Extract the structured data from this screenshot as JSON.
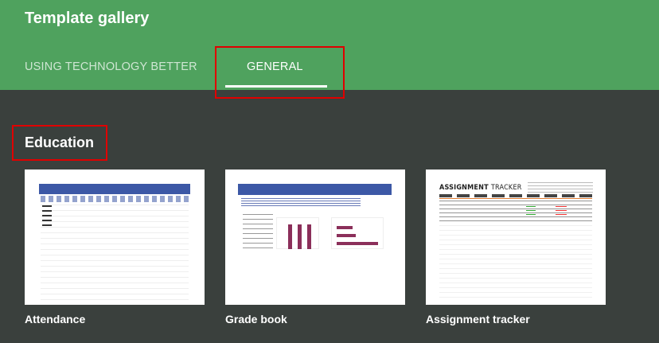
{
  "header": {
    "title": "Template gallery",
    "tabs": [
      {
        "label": "USING TECHNOLOGY BETTER",
        "selected": false
      },
      {
        "label": "GENERAL",
        "selected": true
      }
    ]
  },
  "section": {
    "title": "Education"
  },
  "templates": [
    {
      "label": "Attendance"
    },
    {
      "label": "Grade book"
    },
    {
      "label": "Assignment tracker",
      "preview_title": "ASSIGNMENT",
      "preview_title_light": "TRACKER"
    }
  ],
  "colors": {
    "header_bg": "#4fa25e",
    "page_bg": "#3a403d",
    "highlight": "#e00000",
    "preview_accent": "#3c58a6",
    "preview_bar": "#8b2f5a"
  }
}
